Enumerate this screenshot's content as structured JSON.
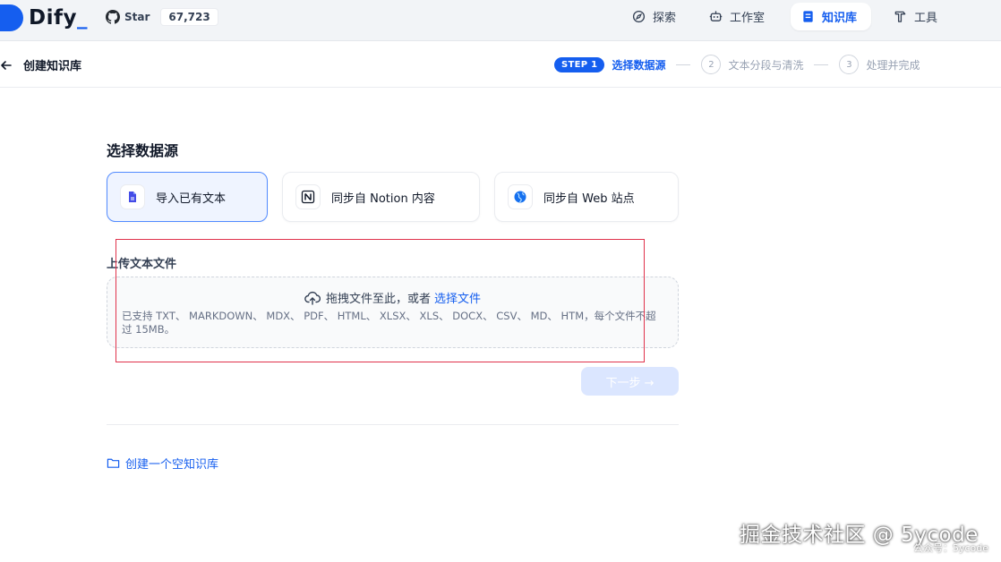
{
  "header": {
    "logo_text": "Dify",
    "logo_cursor": "_",
    "github_label": "Star",
    "github_count": "67,723",
    "nav": {
      "explore": "探索",
      "studio": "工作室",
      "datasets": "知识库",
      "tools": "工具"
    },
    "accent_color": "#155eef"
  },
  "subheader": {
    "title": "创建知识库",
    "steps": {
      "active_badge": "STEP 1",
      "active_label": "选择数据源",
      "step2_num": "2",
      "step2_label": "文本分段与清洗",
      "step3_num": "3",
      "step3_label": "处理并完成"
    }
  },
  "main": {
    "section_title": "选择数据源",
    "sources": {
      "file": "导入已有文本",
      "notion": "同步自 Notion 内容",
      "web": "同步自 Web 站点"
    },
    "upload": {
      "title": "上传文本文件",
      "drop_text": "拖拽文件至此，或者",
      "drop_link": "选择文件",
      "hint": "已支持 TXT、 MARKDOWN、 MDX、 PDF、 HTML、 XLSX、 XLS、 DOCX、 CSV、 MD、 HTM，每个文件不超过 15MB。"
    },
    "next_button": "下一步 →",
    "create_empty": "创建一个空知识库"
  },
  "watermark": {
    "main": "掘金技术社区 @ 5ycode",
    "sub": "公众号：5ycode"
  }
}
